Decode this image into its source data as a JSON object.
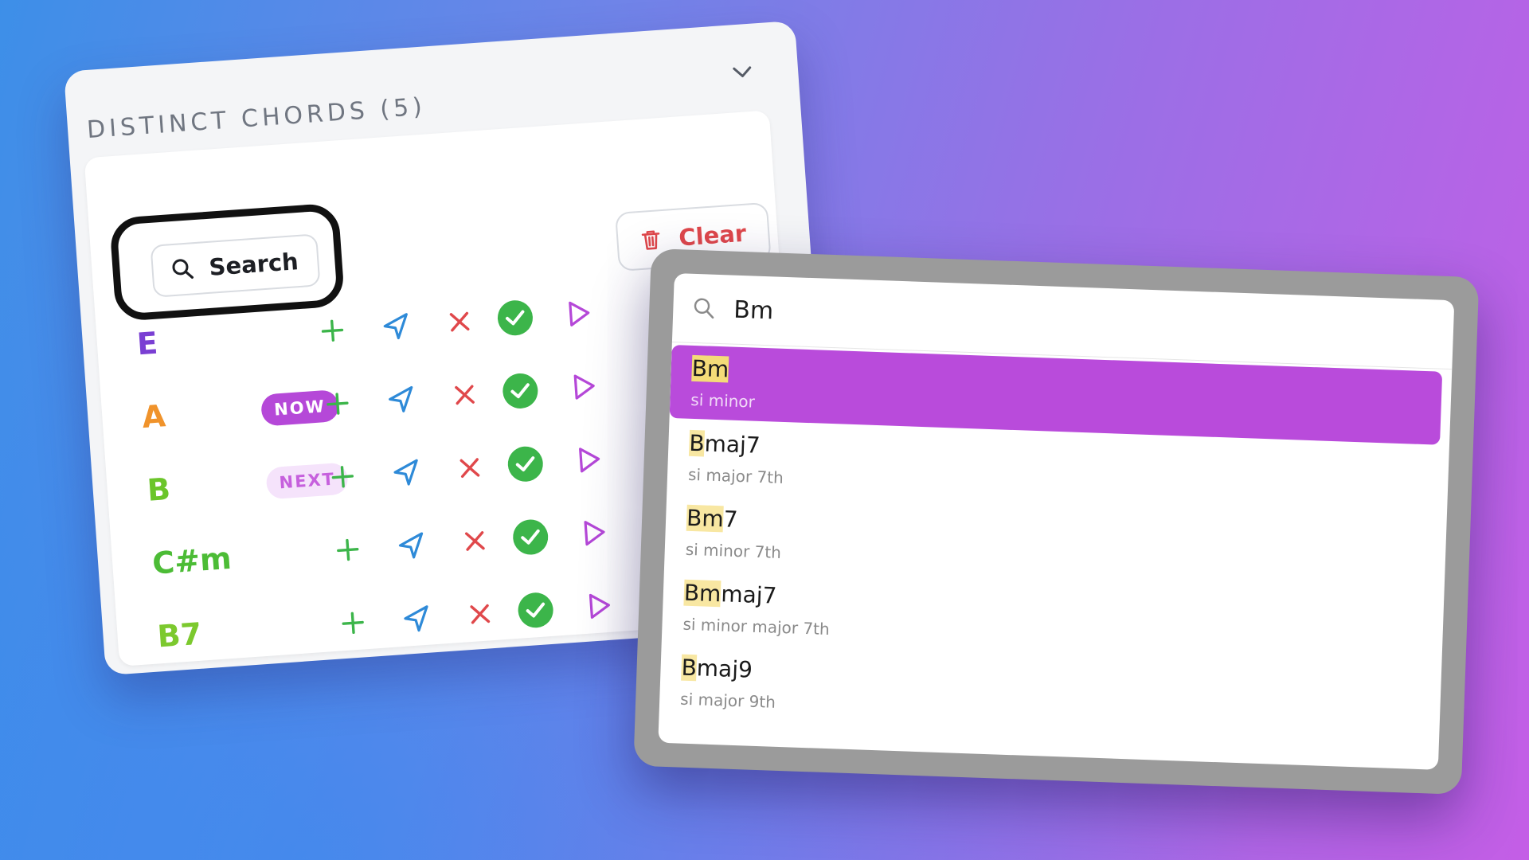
{
  "panel": {
    "title": "DISTINCT CHORDS (5)",
    "search_label": "Search",
    "clear_label": "Clear",
    "chords": [
      {
        "name": "E",
        "color": "#7a3fd3",
        "badge": ""
      },
      {
        "name": "A",
        "color": "#f0932b",
        "badge": "NOW"
      },
      {
        "name": "B",
        "color": "#6bc52a",
        "badge": "NEXT"
      },
      {
        "name": "C#m",
        "color": "#4cbc36",
        "badge": ""
      },
      {
        "name": "B7",
        "color": "#7cc92e",
        "badge": ""
      }
    ],
    "row_actions": [
      "add-icon",
      "send-icon",
      "remove-icon",
      "check-icon",
      "play-icon"
    ]
  },
  "palette": {
    "query": "Bm",
    "results": [
      {
        "match": "Bm",
        "rest": "",
        "desc": "si minor",
        "active": true
      },
      {
        "match": "B",
        "rest": "maj7",
        "desc": "si major 7th",
        "active": false
      },
      {
        "match": "Bm",
        "rest": "7",
        "desc": "si minor 7th",
        "active": false
      },
      {
        "match": "Bm",
        "rest": "maj7",
        "desc": "si minor major 7th",
        "active": false
      },
      {
        "match": "B",
        "rest": "maj9",
        "desc": "si major 9th",
        "active": false
      }
    ]
  },
  "colors": {
    "accent": "#b94bdb",
    "add": "#3cb54a",
    "send": "#2e8ad8",
    "remove": "#e0484b",
    "check": "#3cb54a",
    "play": "#b548d8",
    "highlight": "#f8e7a2"
  }
}
